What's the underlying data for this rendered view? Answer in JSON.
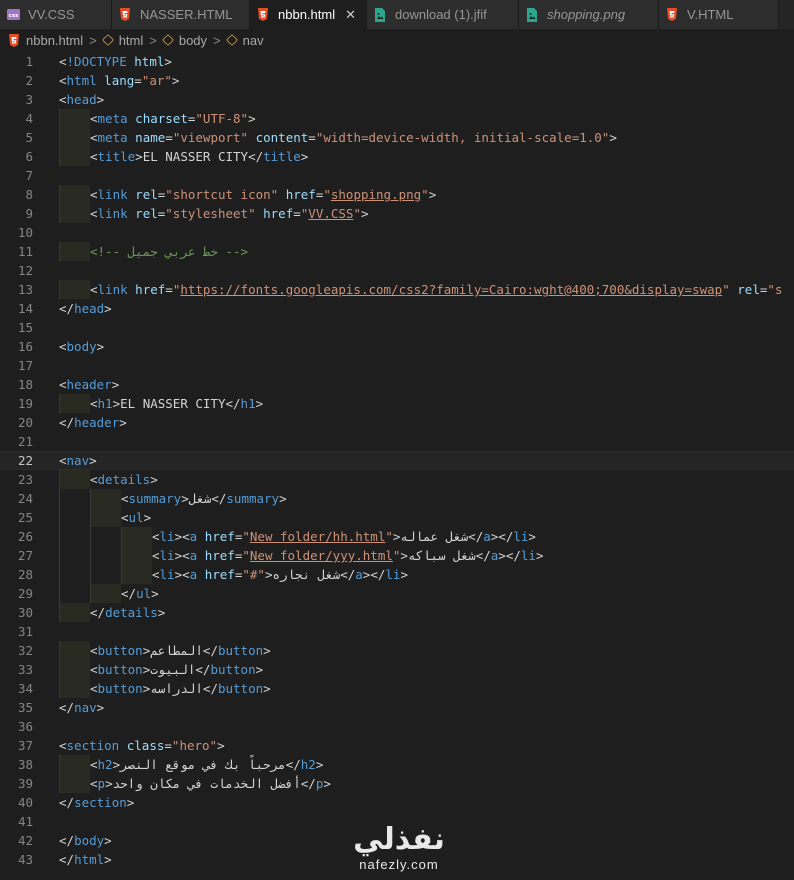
{
  "tabs": [
    {
      "label": "VV.CSS",
      "icon": "css-file-icon",
      "active": false
    },
    {
      "label": "NASSER.HTML",
      "icon": "html5-file-icon",
      "active": false
    },
    {
      "label": "nbbn.html",
      "icon": "html5-file-icon",
      "active": true,
      "close": "✕"
    },
    {
      "label": "download (1).jfif",
      "icon": "image-file-icon",
      "active": false
    },
    {
      "label": "shopping.png",
      "icon": "image-file-icon",
      "active": false
    },
    {
      "label": "V.HTML",
      "icon": "html5-file-icon",
      "active": false
    }
  ],
  "breadcrumb": {
    "file": "nbbn.html",
    "items": [
      "html",
      "body",
      "nav"
    ],
    "separator": ">"
  },
  "editor": {
    "current_line": 22,
    "lines": [
      {
        "n": "1",
        "t": "<!DOCTYPE html>"
      },
      {
        "n": "2",
        "t": "<html lang=\"ar\">"
      },
      {
        "n": "3",
        "t": "<head>"
      },
      {
        "n": "4",
        "t": "    <meta charset=\"UTF-8\">"
      },
      {
        "n": "5",
        "t": "    <meta name=\"viewport\" content=\"width=device-width, initial-scale=1.0\">"
      },
      {
        "n": "6",
        "t": "    <title>EL NASSER CITY</title>"
      },
      {
        "n": "7",
        "t": ""
      },
      {
        "n": "8",
        "t": "    <link rel=\"shortcut icon\" href=\"shopping.png\">"
      },
      {
        "n": "9",
        "t": "    <link rel=\"stylesheet\" href=\"VV.CSS\">"
      },
      {
        "n": "10",
        "t": ""
      },
      {
        "n": "11",
        "t": "    <!-- خط عربي جميل -->"
      },
      {
        "n": "12",
        "t": ""
      },
      {
        "n": "13",
        "t": "    <link href=\"https://fonts.googleapis.com/css2?family=Cairo:wght@400;700&display=swap\" rel=\"s"
      },
      {
        "n": "14",
        "t": "</head>"
      },
      {
        "n": "15",
        "t": ""
      },
      {
        "n": "16",
        "t": "<body>"
      },
      {
        "n": "17",
        "t": ""
      },
      {
        "n": "18",
        "t": "<header>"
      },
      {
        "n": "19",
        "t": "    <h1>EL NASSER CITY</h1>"
      },
      {
        "n": "20",
        "t": "</header>"
      },
      {
        "n": "21",
        "t": ""
      },
      {
        "n": "22",
        "t": "<nav>"
      },
      {
        "n": "23",
        "t": "    <details>"
      },
      {
        "n": "24",
        "t": "        <summary>شغل</summary>"
      },
      {
        "n": "25",
        "t": "        <ul>"
      },
      {
        "n": "26",
        "t": "            <li><a href=\"New folder/hh.html\">شغل عماله</a></li>"
      },
      {
        "n": "27",
        "t": "            <li><a href=\"New folder/yyy.html\">شغل سباكه</a></li>"
      },
      {
        "n": "28",
        "t": "            <li><a href=\"#\">شغل نجاره</a></li>"
      },
      {
        "n": "29",
        "t": "        </ul>"
      },
      {
        "n": "30",
        "t": "    </details>"
      },
      {
        "n": "31",
        "t": ""
      },
      {
        "n": "32",
        "t": "    <button>المطاعم</button>"
      },
      {
        "n": "33",
        "t": "    <button>البيوت</button>"
      },
      {
        "n": "34",
        "t": "    <button>الدراسه</button>"
      },
      {
        "n": "35",
        "t": "</nav>"
      },
      {
        "n": "36",
        "t": ""
      },
      {
        "n": "37",
        "t": "<section class=\"hero\">"
      },
      {
        "n": "38",
        "t": "    <h2>مرحباً بك في موقع النصر</h2>"
      },
      {
        "n": "39",
        "t": "    <p>أفضل الخدمات في مكان واحد</p>"
      },
      {
        "n": "40",
        "t": "</section>"
      },
      {
        "n": "41",
        "t": ""
      },
      {
        "n": "42",
        "t": "</body>"
      },
      {
        "n": "43",
        "t": "</html>"
      }
    ]
  },
  "watermark": {
    "arabic": "نفذلي",
    "latin": "nafezly.com"
  },
  "colors": {
    "background": "#1e1e1e",
    "tag": "#569cd6",
    "attribute": "#9cdcfe",
    "string": "#ce9178",
    "comment": "#6a9955",
    "html_icon": "#e44d26",
    "image_icon": "#29a88e",
    "css_icon": "#a074c4"
  }
}
